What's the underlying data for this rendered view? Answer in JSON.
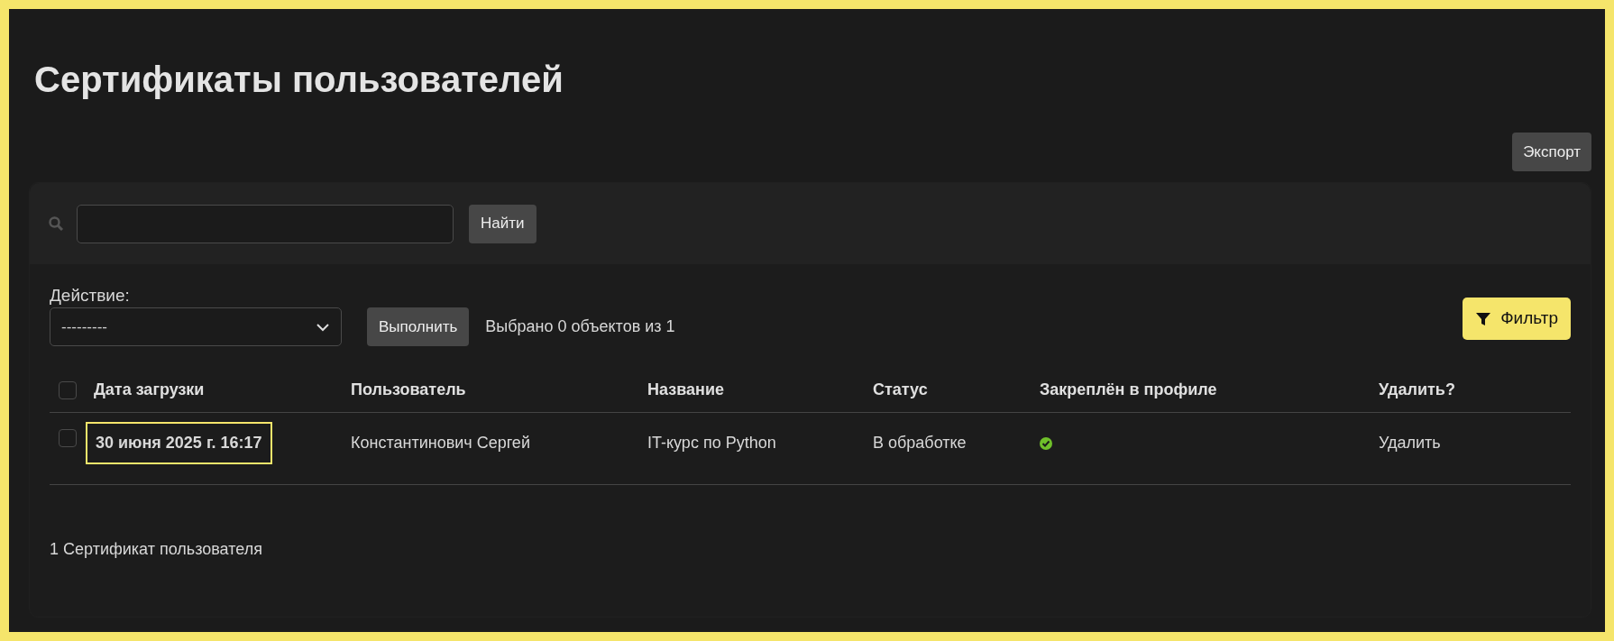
{
  "title": "Сертификаты пользователей",
  "export_button": "Экспорт",
  "search": {
    "button": "Найти"
  },
  "action": {
    "label": "Действие:",
    "value": "---------",
    "button": "Выполнить",
    "selection_info": "Выбрано 0 объектов из 1"
  },
  "filter_button": "Фильтр",
  "table": {
    "select_all_checked": false,
    "columns": [
      "Дата загрузки",
      "Пользователь",
      "Название",
      "Статус",
      "Закреплён в профиле",
      "Удалить?"
    ],
    "rows": [
      {
        "checked": false,
        "date": "30 июня 2025 г. 16:17",
        "date_focused": true,
        "user": "Константинович Сергей",
        "name": "IT-курс по Python",
        "status": "В обработке",
        "pinned": true,
        "delete": "Удалить"
      }
    ]
  },
  "footer": "1 Сертификат пользователя"
}
